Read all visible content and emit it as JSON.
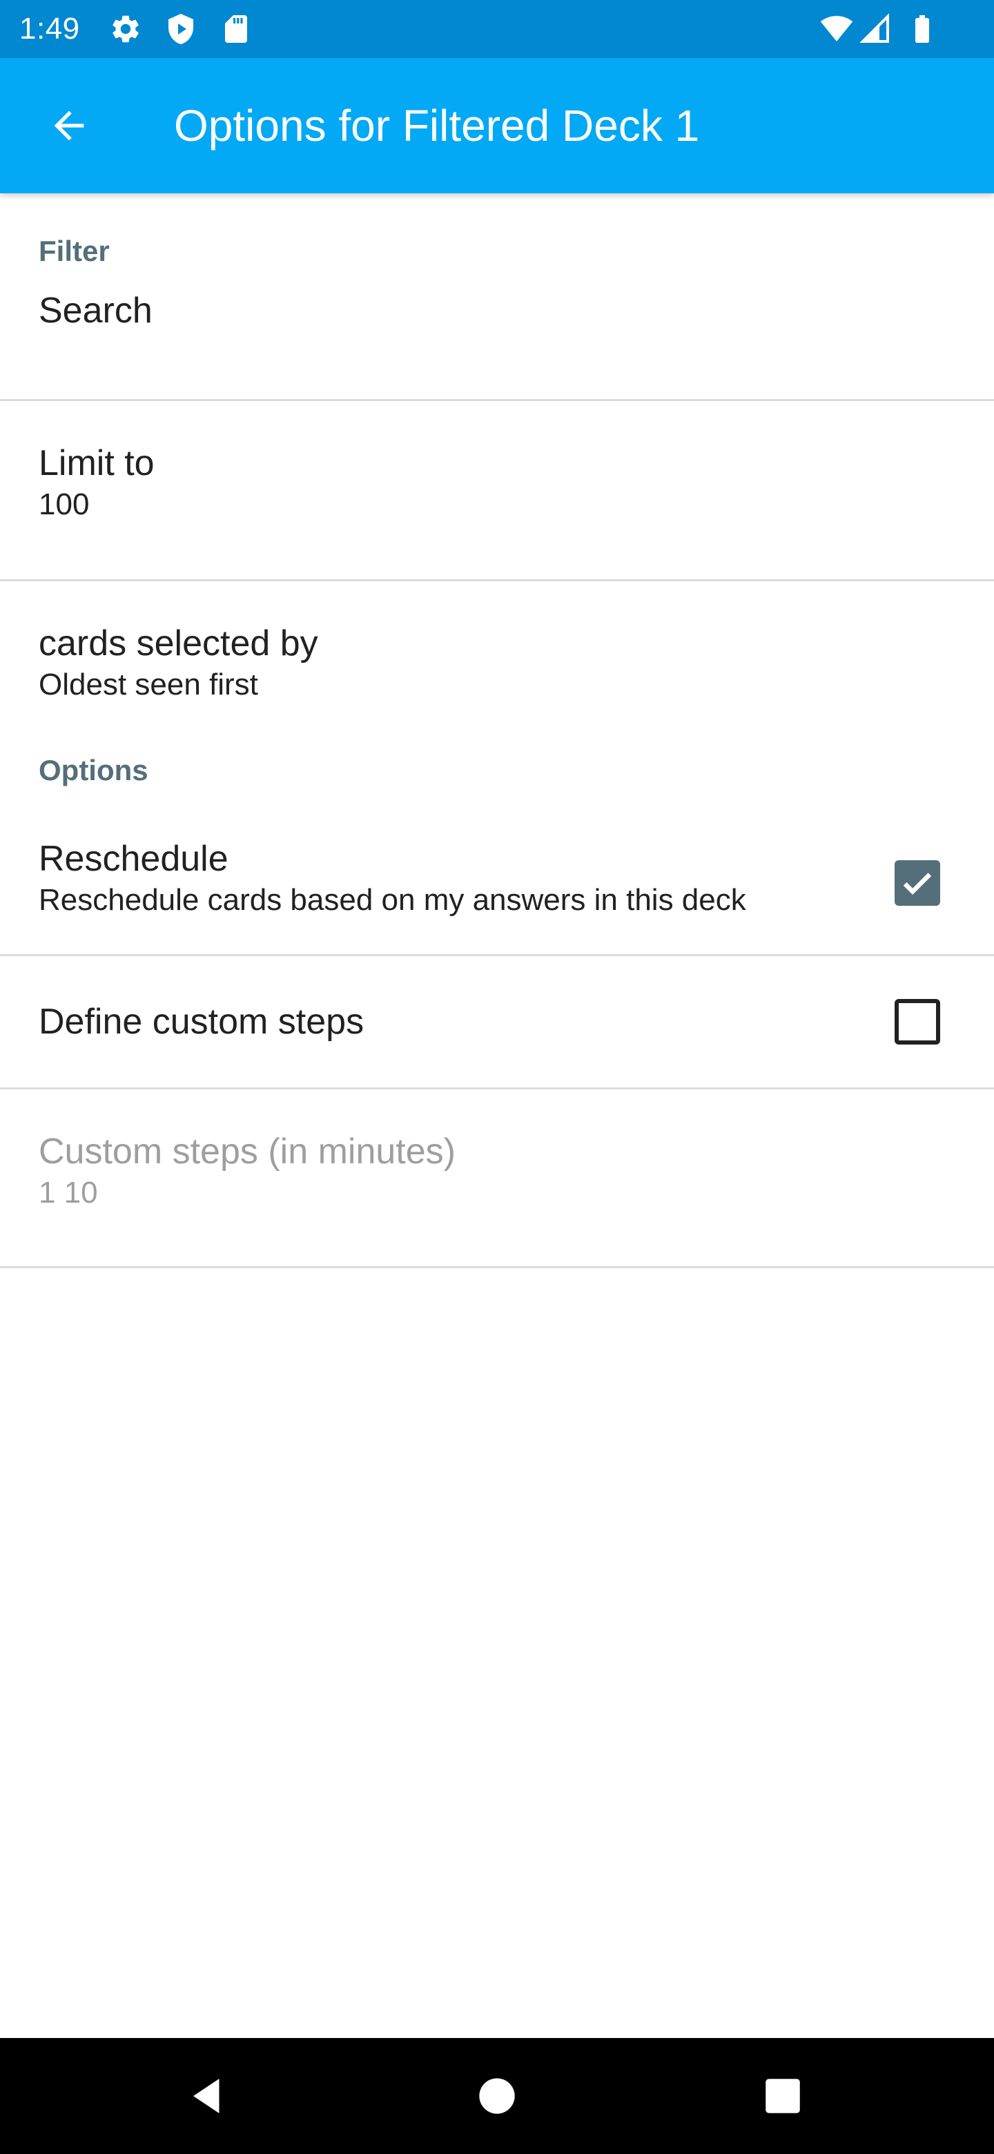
{
  "status_bar": {
    "time": "1:49",
    "icons": [
      "gear-icon",
      "shield-icon",
      "sd-card-icon",
      "wifi-icon",
      "cell-signal-icon",
      "battery-icon"
    ]
  },
  "app_bar": {
    "back_icon": "arrow-back-icon",
    "title": "Options for Filtered Deck 1"
  },
  "categories": {
    "filter": "Filter",
    "options": "Options"
  },
  "preferences": {
    "search": {
      "title": "Search"
    },
    "limit_to": {
      "title": "Limit to",
      "summary": "100"
    },
    "cards_selected_by": {
      "title": "cards selected by",
      "summary": "Oldest seen first"
    },
    "reschedule": {
      "title": "Reschedule",
      "summary": "Reschedule cards based on my answers in this deck",
      "checked": true
    },
    "define_custom_steps": {
      "title": "Define custom steps",
      "checked": false
    },
    "custom_steps": {
      "title": "Custom steps (in minutes)",
      "summary": "1 10",
      "enabled": false
    }
  },
  "nav_bar": {
    "icons": [
      "back-triangle-icon",
      "home-circle-icon",
      "recents-square-icon"
    ]
  },
  "colors": {
    "status_bar": "#0288d1",
    "app_bar": "#03a9f4",
    "category_text": "#546e7a",
    "checkbox_checked": "#546e7a",
    "text_primary": "#212121",
    "text_disabled": "#9e9e9e",
    "divider": "#dcdcdc",
    "nav_bar": "#000000"
  }
}
